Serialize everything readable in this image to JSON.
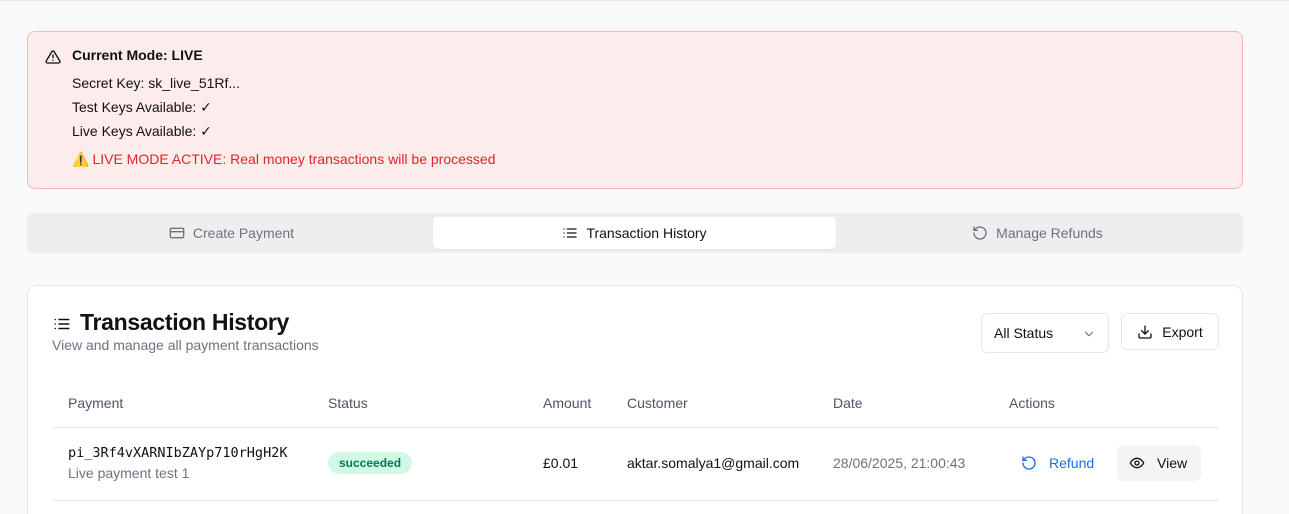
{
  "alert": {
    "icon": "alert-triangle-icon",
    "title": "Current Mode: LIVE",
    "secret_key": "Secret Key: sk_live_51Rf...",
    "test_keys": "Test Keys Available: ✓",
    "live_keys": "Live Keys Available: ✓",
    "warning_emoji": "⚠️",
    "warning_text": "LIVE MODE ACTIVE: Real money transactions will be processed",
    "colors": {
      "background": "#fdecec",
      "border": "#f4b8b8",
      "danger": "#dc2626"
    }
  },
  "tabs": [
    {
      "label": "Create Payment",
      "icon": "credit-card-icon",
      "active": false
    },
    {
      "label": "Transaction History",
      "icon": "list-icon",
      "active": true
    },
    {
      "label": "Manage Refunds",
      "icon": "rotate-ccw-icon",
      "active": false
    }
  ],
  "card": {
    "icon": "list-icon",
    "title": "Transaction History",
    "subtitle": "View and manage all payment transactions",
    "filter": {
      "selected": "All Status",
      "icon": "chevron-down-icon"
    },
    "export_label": "Export",
    "export_icon": "download-icon"
  },
  "table": {
    "headers": [
      "Payment",
      "Status",
      "Amount",
      "Customer",
      "Date",
      "Actions"
    ],
    "rows": [
      {
        "payment_id": "pi_3Rf4vXARNIbZAYp710rHgH2K",
        "description": "Live payment test 1",
        "status": "succeeded",
        "amount": "£0.01",
        "customer": "aktar.somalya1@gmail.com",
        "date": "28/06/2025, 21:00:43",
        "refund_label": "Refund",
        "view_label": "View"
      }
    ],
    "colors": {
      "badge_bg": "#d1fae5",
      "badge_text": "#047857",
      "refund": "#1d6ee6"
    }
  }
}
